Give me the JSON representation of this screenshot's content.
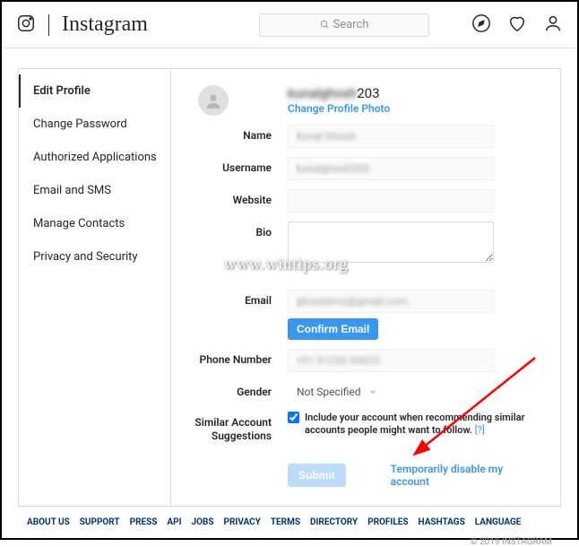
{
  "header": {
    "logo": "Instagram",
    "search_placeholder": "Search"
  },
  "sidebar": {
    "items": [
      {
        "label": "Edit Profile",
        "active": true
      },
      {
        "label": "Change Password",
        "active": false
      },
      {
        "label": "Authorized Applications",
        "active": false
      },
      {
        "label": "Email and SMS",
        "active": false
      },
      {
        "label": "Manage Contacts",
        "active": false
      },
      {
        "label": "Privacy and Security",
        "active": false
      }
    ]
  },
  "profile": {
    "display_name_blurred": "kunalghosh",
    "display_name_suffix": "203",
    "change_photo_label": "Change Profile Photo",
    "labels": {
      "name": "Name",
      "username": "Username",
      "website": "Website",
      "bio": "Bio",
      "email": "Email",
      "phone": "Phone Number",
      "gender": "Gender",
      "suggestions": "Similar Account Suggestions"
    },
    "values": {
      "name": "Kunal Ghosh",
      "username": "kunalghosh203",
      "website": "",
      "bio": "",
      "email": "gksystems@gmail.com",
      "phone": "+91 91230 54623",
      "gender": "Not Specified"
    },
    "confirm_email_label": "Confirm Email",
    "suggestions_text": "Include your account when recommending similar accounts people might want to follow.",
    "suggestions_help": "[?]",
    "submit_label": "Submit",
    "disable_link": "Temporarily disable my account"
  },
  "footer": {
    "links": [
      "ABOUT US",
      "SUPPORT",
      "PRESS",
      "API",
      "JOBS",
      "PRIVACY",
      "TERMS",
      "DIRECTORY",
      "PROFILES",
      "HASHTAGS",
      "LANGUAGE"
    ],
    "copyright": "© 2019 INSTAGRAM"
  },
  "watermark": "www.wintips.org"
}
